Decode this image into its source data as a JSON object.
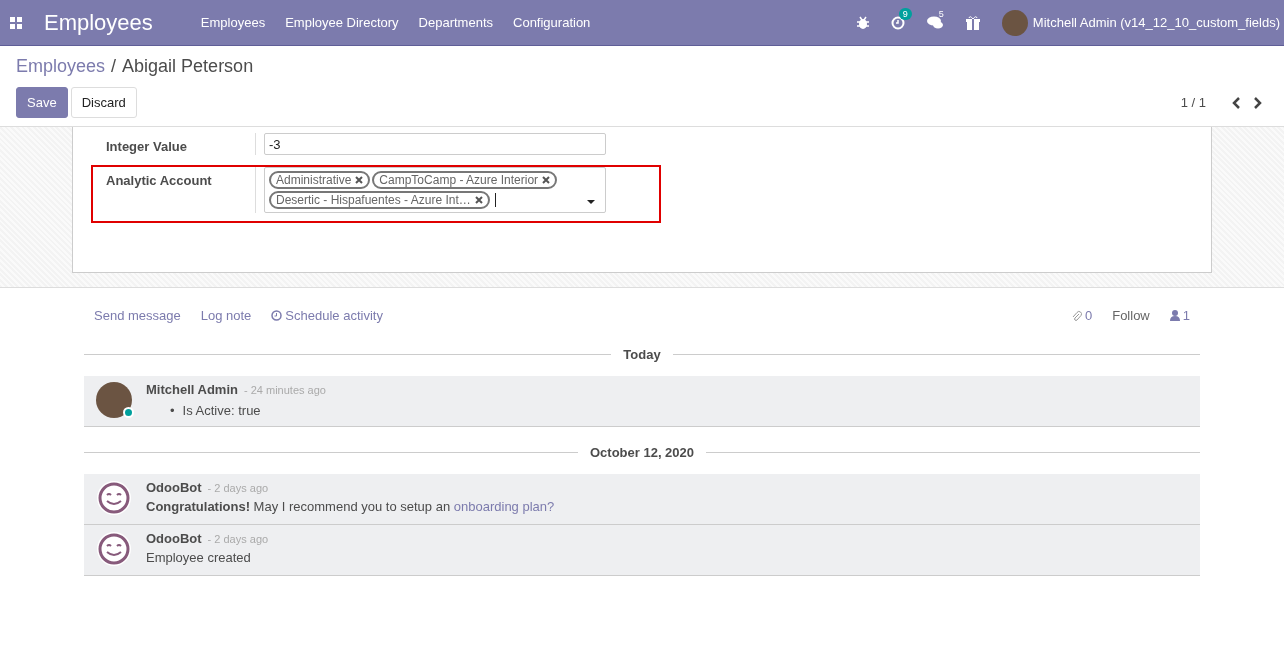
{
  "navbar": {
    "app_title": "Employees",
    "menu": [
      "Employees",
      "Employee Directory",
      "Departments",
      "Configuration"
    ],
    "activity_count": "9",
    "message_count": "5",
    "user": "Mitchell Admin (v14_12_10_custom_fields)"
  },
  "breadcrumb": {
    "parent": "Employees",
    "separator": "/",
    "current": "Abigail Peterson"
  },
  "buttons": [
    {
      "label": "Save",
      "kind": "primary"
    },
    {
      "label": "Discard",
      "kind": "secondary"
    }
  ],
  "pager": "1 / 1",
  "fields": [
    {
      "label": "Integer Value",
      "kind": "text",
      "value": "-3",
      "highlighted": false
    },
    {
      "label": "Analytic Account",
      "kind": "tags",
      "tags": [
        "Administrative",
        "CampToCamp - Azure Interior",
        "Desertic - Hispafuentes - Azure Int…"
      ],
      "highlighted": true
    }
  ],
  "chatter": {
    "actions": [
      "Send message",
      "Log note",
      "Schedule activity"
    ],
    "attachments": "0",
    "follow": "Follow",
    "followers": "1",
    "groups": [
      {
        "date": "Today",
        "messages": [
          {
            "author": "Mitchell Admin",
            "kind": "person",
            "online": true,
            "time": "- 24 minutes ago",
            "bullet": "•",
            "body": "Is Active: true"
          }
        ]
      },
      {
        "date": "October 12, 2020",
        "messages": [
          {
            "author": "OdooBot",
            "kind": "bot",
            "online": false,
            "time": "- 2 days ago",
            "body": "**Congratulations!** May I recommend you to setup an ",
            "link": "onboarding plan?"
          },
          {
            "author": "OdooBot",
            "kind": "bot",
            "online": false,
            "time": "- 2 days ago",
            "body": "Employee created"
          }
        ]
      }
    ]
  }
}
